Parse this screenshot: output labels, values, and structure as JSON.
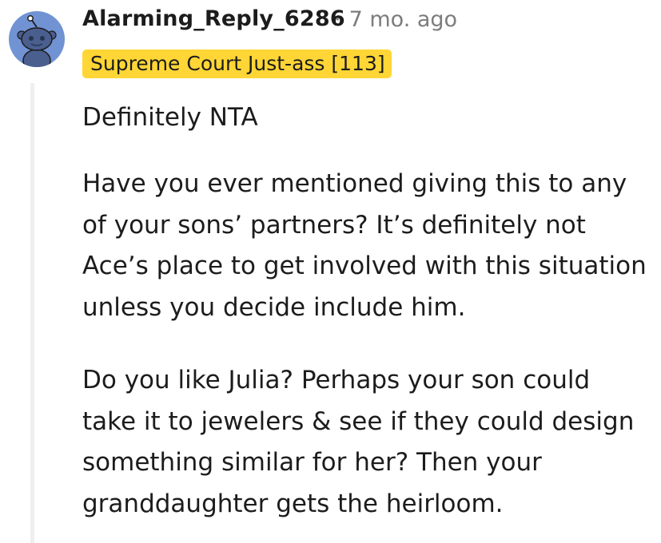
{
  "comment": {
    "author": "Alarming_Reply_6286",
    "separator": "·",
    "timestamp": "7 mo. ago",
    "flair": "Supreme Court Just-ass [113]",
    "avatar_icon": "reddit-snoo-avatar-icon",
    "paragraphs": [
      "Definitely NTA",
      "Have you ever mentioned giving this to any of your sons’ partners? It’s definitely not Ace’s place to get involved with this situation unless you decide include him.",
      "Do you like Julia? Perhaps your son could take it to jewelers & see if they could design something similar for her? Then your granddaughter gets the heirloom."
    ]
  },
  "colors": {
    "avatar_bg": "#7193d3",
    "flair_bg": "#ffd635",
    "text": "#1c1c1c",
    "meta": "#7c7c7c",
    "thread_line": "#edeff1"
  }
}
